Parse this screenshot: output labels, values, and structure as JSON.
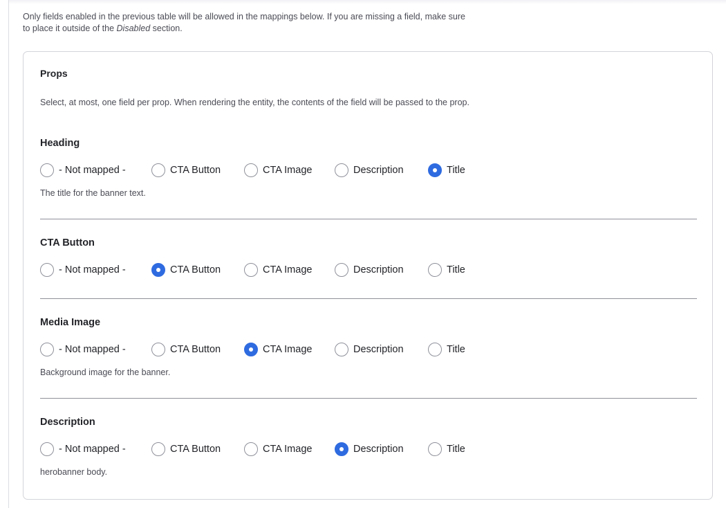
{
  "intro": {
    "text_before": "Only fields enabled in the previous table will be allowed in the mappings below. If you are missing a field, make sure to place it outside of the ",
    "emphasis": "Disabled",
    "text_after": " section."
  },
  "props": {
    "title": "Props",
    "description": "Select, at most, one field per prop. When rendering the entity, the contents of the field will be passed to the prop.",
    "groups": [
      {
        "label": "Heading",
        "options": [
          "- Not mapped -",
          "CTA Button",
          "CTA Image",
          "Description",
          "Title"
        ],
        "selected": "Title",
        "help": "The title for the banner text."
      },
      {
        "label": "CTA Button",
        "options": [
          "- Not mapped -",
          "CTA Button",
          "CTA Image",
          "Description",
          "Title"
        ],
        "selected": "CTA Button",
        "help": ""
      },
      {
        "label": "Media Image",
        "options": [
          "- Not mapped -",
          "CTA Button",
          "CTA Image",
          "Description",
          "Title"
        ],
        "selected": "CTA Image",
        "help": "Background image for the banner."
      },
      {
        "label": "Description",
        "options": [
          "- Not mapped -",
          "CTA Button",
          "CTA Image",
          "Description",
          "Title"
        ],
        "selected": "Description",
        "help": "herobanner body."
      }
    ]
  },
  "colors": {
    "accent": "#2f6be0",
    "text": "#232429",
    "muted": "#4a4b55",
    "border": "#d3d4d9"
  }
}
